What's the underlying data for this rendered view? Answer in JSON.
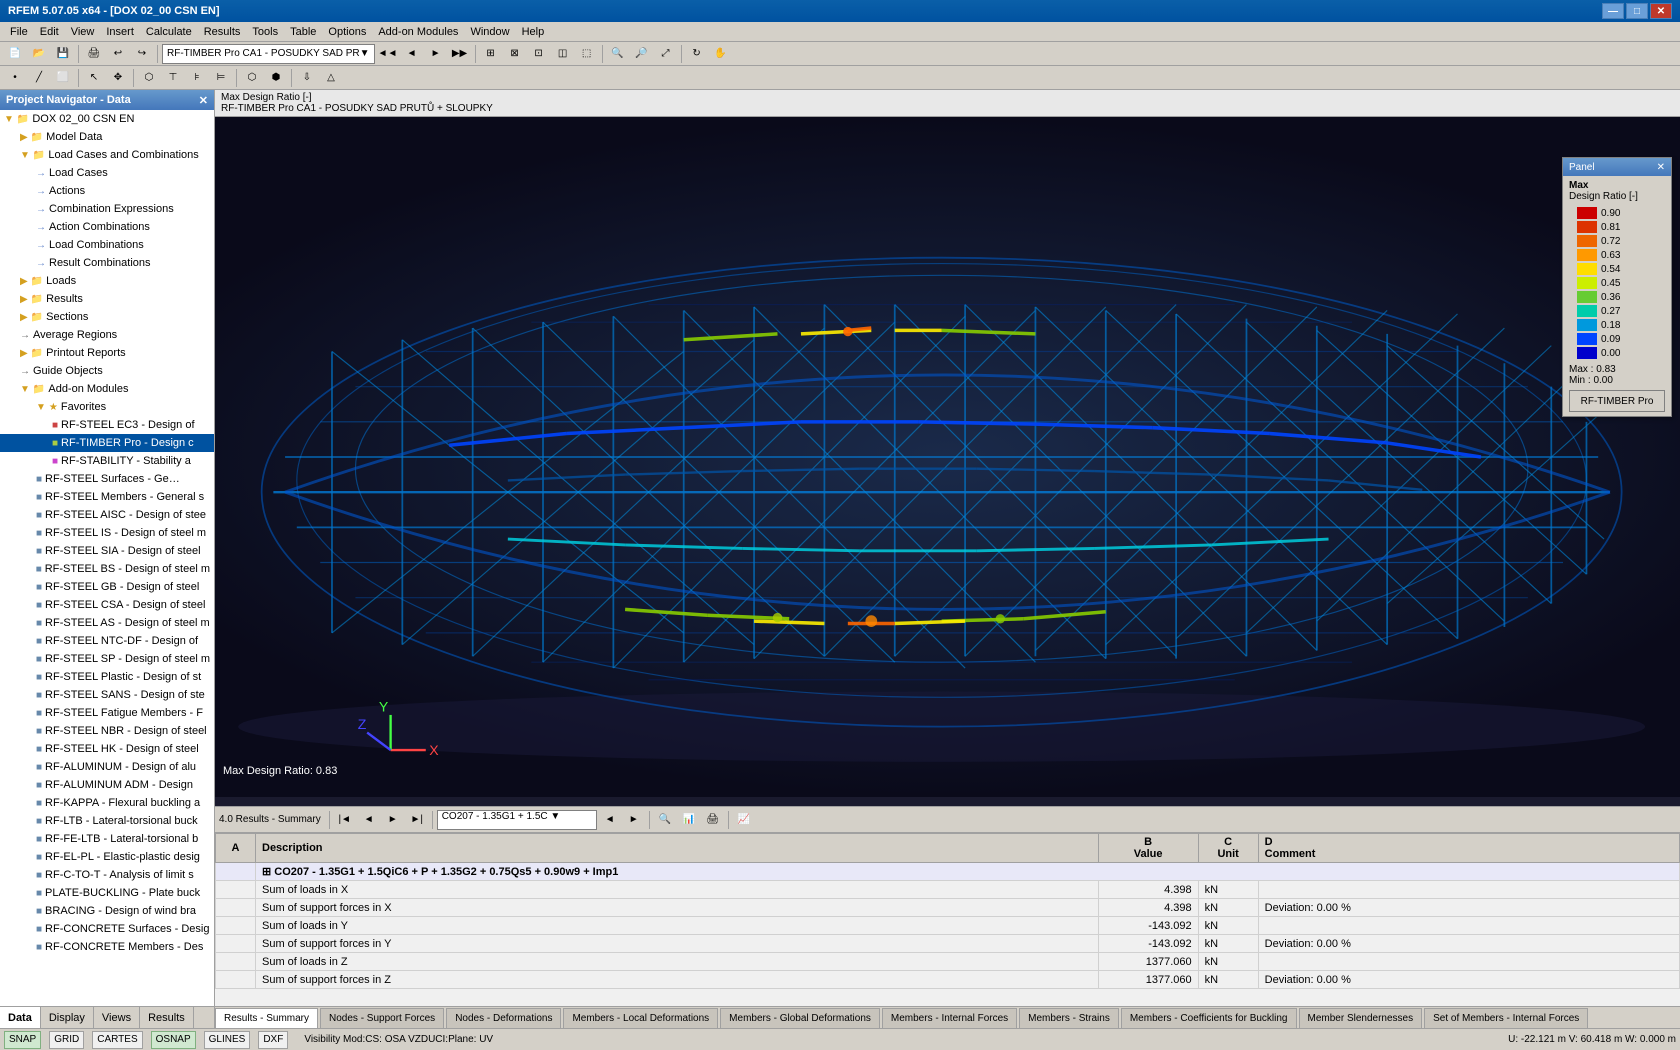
{
  "titleBar": {
    "title": "RFEM 5.07.05 x64 - [DOX 02_00 CSN EN]",
    "controls": [
      "minimize",
      "maximize",
      "close"
    ]
  },
  "menu": {
    "items": [
      "File",
      "Edit",
      "View",
      "Insert",
      "Calculate",
      "Results",
      "Tools",
      "Table",
      "Options",
      "Add-on Modules",
      "Window",
      "Help"
    ]
  },
  "toolbar": {
    "dropdown": "RF-TIMBER Pro CA1 - POSUDKY SAD PR",
    "navButtons": [
      "◄",
      "►",
      "◄◄",
      "▶▶"
    ]
  },
  "projectNavigator": {
    "title": "Project Navigator - Data",
    "root": "DOX 02_00 CSN EN",
    "tree": [
      {
        "label": "Model Data",
        "level": 1,
        "type": "folder"
      },
      {
        "label": "Load Cases and Combinations",
        "level": 1,
        "type": "folder",
        "expanded": true
      },
      {
        "label": "Load Cases",
        "level": 2,
        "type": "item"
      },
      {
        "label": "Actions",
        "level": 2,
        "type": "item"
      },
      {
        "label": "Combination Expressions",
        "level": 2,
        "type": "item"
      },
      {
        "label": "Action Combinations",
        "level": 2,
        "type": "item"
      },
      {
        "label": "Load Combinations",
        "level": 2,
        "type": "item"
      },
      {
        "label": "Result Combinations",
        "level": 2,
        "type": "item"
      },
      {
        "label": "Loads",
        "level": 1,
        "type": "folder"
      },
      {
        "label": "Results",
        "level": 1,
        "type": "folder"
      },
      {
        "label": "Sections",
        "level": 1,
        "type": "folder"
      },
      {
        "label": "Average Regions",
        "level": 1,
        "type": "item"
      },
      {
        "label": "Printout Reports",
        "level": 1,
        "type": "folder"
      },
      {
        "label": "Guide Objects",
        "level": 1,
        "type": "item"
      },
      {
        "label": "Add-on Modules",
        "level": 1,
        "type": "folder",
        "expanded": true
      },
      {
        "label": "Favorites",
        "level": 2,
        "type": "folder",
        "expanded": true
      },
      {
        "label": "RF-STEEL EC3 - Design of",
        "level": 3,
        "type": "addon"
      },
      {
        "label": "RF-TIMBER Pro - Design c",
        "level": 3,
        "type": "addon",
        "selected": true
      },
      {
        "label": "RF-STABILITY - Stability a",
        "level": 3,
        "type": "addon"
      },
      {
        "label": "RF-STEEL Surfaces - General st",
        "level": 2,
        "type": "addon"
      },
      {
        "label": "RF-STEEL Members - General s",
        "level": 2,
        "type": "addon"
      },
      {
        "label": "RF-STEEL AISC - Design of stee",
        "level": 2,
        "type": "addon"
      },
      {
        "label": "RF-STEEL IS - Design of steel m",
        "level": 2,
        "type": "addon"
      },
      {
        "label": "RF-STEEL SIA - Design of steel",
        "level": 2,
        "type": "addon"
      },
      {
        "label": "RF-STEEL BS - Design of steel m",
        "level": 2,
        "type": "addon"
      },
      {
        "label": "RF-STEEL GB - Design of steel",
        "level": 2,
        "type": "addon"
      },
      {
        "label": "RF-STEEL CSA - Design of steel",
        "level": 2,
        "type": "addon"
      },
      {
        "label": "RF-STEEL AS - Design of steel m",
        "level": 2,
        "type": "addon"
      },
      {
        "label": "RF-STEEL NTC-DF - Design of",
        "level": 2,
        "type": "addon"
      },
      {
        "label": "RF-STEEL SP - Design of steel m",
        "level": 2,
        "type": "addon"
      },
      {
        "label": "RF-STEEL Plastic - Design of st",
        "level": 2,
        "type": "addon"
      },
      {
        "label": "RF-STEEL SANS - Design of ste",
        "level": 2,
        "type": "addon"
      },
      {
        "label": "RF-STEEL Fatigue Members - F",
        "level": 2,
        "type": "addon"
      },
      {
        "label": "RF-STEEL NBR - Design of steel",
        "level": 2,
        "type": "addon"
      },
      {
        "label": "RF-STEEL HK - Design of steel",
        "level": 2,
        "type": "addon"
      },
      {
        "label": "RF-ALUMINUM - Design of alu",
        "level": 2,
        "type": "addon"
      },
      {
        "label": "RF-ALUMINUM ADM - Design",
        "level": 2,
        "type": "addon"
      },
      {
        "label": "RF-KAPPA - Flexural buckling a",
        "level": 2,
        "type": "addon"
      },
      {
        "label": "RF-LTB - Lateral-torsional buck",
        "level": 2,
        "type": "addon"
      },
      {
        "label": "RF-FE-LTB - Lateral-torsional b",
        "level": 2,
        "type": "addon"
      },
      {
        "label": "RF-EL-PL - Elastic-plastic desig",
        "level": 2,
        "type": "addon"
      },
      {
        "label": "RF-C-TO-T - Analysis of limit s",
        "level": 2,
        "type": "addon"
      },
      {
        "label": "PLATE-BUCKLING - Plate buck",
        "level": 2,
        "type": "addon"
      },
      {
        "label": "BRACING - Design of wind bra",
        "level": 2,
        "type": "addon"
      },
      {
        "label": "RF-CONCRETE Surfaces - Desig",
        "level": 2,
        "type": "addon"
      },
      {
        "label": "RF-CONCRETE Members - Des",
        "level": 2,
        "type": "addon"
      }
    ],
    "tabs": [
      "Data",
      "Display",
      "Views",
      "Results"
    ]
  },
  "viewport": {
    "header": {
      "line1": "Max Design Ratio [-]",
      "line2": "RF-TIMBER Pro CA1 - POSUDKY SAD PRUTŮ + SLOUPKY"
    },
    "maxLabel": "Max Design Ratio: 0.83"
  },
  "colorPanel": {
    "title": "Panel",
    "subtitle": "Max",
    "label": "Design Ratio [-]",
    "scale": [
      {
        "value": "0.90",
        "color": "#cc0000"
      },
      {
        "value": "0.81",
        "color": "#dd2200"
      },
      {
        "value": "0.72",
        "color": "#ee5500"
      },
      {
        "value": "0.63",
        "color": "#ff8800"
      },
      {
        "value": "0.54",
        "color": "#ffcc00"
      },
      {
        "value": "0.45",
        "color": "#ddee00"
      },
      {
        "value": "0.36",
        "color": "#88cc00"
      },
      {
        "value": "0.27",
        "color": "#00aa88"
      },
      {
        "value": "0.18",
        "color": "#0088cc"
      },
      {
        "value": "0.09",
        "color": "#0044ee"
      },
      {
        "value": "0.00",
        "color": "#0000cc"
      }
    ],
    "maxValue": "0.83",
    "minValue": "0.00",
    "button": "RF-TIMBER Pro"
  },
  "resultsPanel": {
    "toolbar": {
      "combo": "CO207 - 1.35G1 + 1.5C",
      "navBtns": [
        "◄◄",
        "◄",
        "►",
        "▶▶"
      ]
    },
    "title": "4.0 Results - Summary",
    "columns": [
      "",
      "A Description",
      "B Value",
      "C Unit",
      "D Comment"
    ],
    "rows": [
      {
        "type": "combo",
        "desc": "CO207 - 1.35G1 + 1.5QiC6 + P + 1.35G2 + 0.75Qs5 + 0.90w9 + Imp1",
        "value": "",
        "unit": "",
        "comment": ""
      },
      {
        "type": "normal",
        "desc": "Sum of loads in X",
        "value": "4.398",
        "unit": "kN",
        "comment": ""
      },
      {
        "type": "normal",
        "desc": "Sum of support forces in X",
        "value": "4.398",
        "unit": "kN",
        "comment": "Deviation: 0.00 %"
      },
      {
        "type": "normal",
        "desc": "Sum of loads in Y",
        "value": "-143.092",
        "unit": "kN",
        "comment": ""
      },
      {
        "type": "normal",
        "desc": "Sum of support forces in Y",
        "value": "-143.092",
        "unit": "kN",
        "comment": "Deviation: 0.00 %"
      },
      {
        "type": "normal",
        "desc": "Sum of loads in Z",
        "value": "1377.060",
        "unit": "kN",
        "comment": ""
      },
      {
        "type": "normal",
        "desc": "Sum of support forces in Z",
        "value": "1377.060",
        "unit": "kN",
        "comment": "Deviation: 0.00 %"
      }
    ]
  },
  "bottomTabs": [
    "Results - Summary",
    "Nodes - Support Forces",
    "Nodes - Deformations",
    "Members - Local Deformations",
    "Members - Global Deformations",
    "Members - Internal Forces",
    "Members - Strains",
    "Members - Coefficients for Buckling",
    "Member Slendernesses",
    "Set of Members - Internal Forces"
  ],
  "statusBar": {
    "items": [
      "SNAP",
      "GRID",
      "CARTES",
      "OSNAP",
      "GLINES",
      "DXF"
    ],
    "active": [
      "OSNAP"
    ],
    "visibility": "Visibility Mod:CS: OSA VZDUCI:Plane: UV",
    "coords": "U: -22.121 m   V: 60.418 m   W: 0.000 m"
  }
}
